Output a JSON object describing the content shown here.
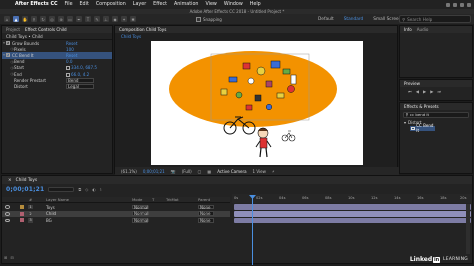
{
  "menubar": {
    "app_name": "After Effects CC",
    "items": [
      "File",
      "Edit",
      "Composition",
      "Layer",
      "Effect",
      "Animation",
      "View",
      "Window",
      "Help"
    ]
  },
  "window_title": "Adobe After Effects CC 2018 - Untitled Project *",
  "toolbar": {
    "snapping_label": "Snapping",
    "workspaces": [
      "Default",
      "Standard",
      "Small Screen"
    ],
    "active_workspace": "Standard",
    "help_search_placeholder": "Search Help"
  },
  "left_panel": {
    "tabs": [
      "Project",
      "Effect Controls Child"
    ],
    "active_tab": "Effect Controls Child",
    "layer_path": "Child Toys • Child",
    "effects": [
      {
        "name": "Grow Bounds",
        "reset": "Reset"
      },
      {
        "name": "Pixels",
        "value": "100",
        "indent": 1
      },
      {
        "name": "CC Bend It",
        "reset": "Reset",
        "highlighted": true
      },
      {
        "name": "Bend",
        "value": "0.0",
        "indent": 1
      },
      {
        "name": "Start",
        "value": "334.0, 687.5",
        "indent": 1
      },
      {
        "name": "End",
        "value": "66.0, 4.2",
        "indent": 1
      },
      {
        "name": "Render Prestart",
        "select": "Bend",
        "indent": 1
      },
      {
        "name": "Distort",
        "select": "Legal",
        "indent": 1
      }
    ]
  },
  "composition_panel": {
    "tab_label": "Composition Child Toys",
    "breadcrumb": "Child Toys",
    "zoom": "(61.1%)",
    "timecode": "0;00;01;21",
    "resolution": "(Full)",
    "camera": "Active Camera",
    "views": "1 View"
  },
  "right_panels": {
    "info_tabs": [
      "Info",
      "Audio"
    ],
    "preview_tab": "Preview",
    "effects_presets_tab": "Effects & Presets",
    "effects_search_value": "cc bend it",
    "category": "Distort",
    "result": "CC Bend It"
  },
  "timeline": {
    "tab_label": "Child Toys",
    "timecode": "0;00;01;21",
    "columns": [
      "#",
      "Layer Name",
      "Mode",
      "T",
      "TrkMat",
      "Parent"
    ],
    "layers": [
      {
        "number": "1",
        "name": "Toys",
        "mode": "Normal",
        "parent": "None",
        "label_color": "#b58c3c"
      },
      {
        "number": "2",
        "name": "Child",
        "mode": "Normal",
        "parent": "None",
        "label_color": "#b06070",
        "selected": true
      },
      {
        "number": "3",
        "name": "BG",
        "mode": "Normal",
        "parent": "None",
        "label_color": "#b06070"
      }
    ],
    "ruler_ticks": [
      "0s",
      "02s",
      "04s",
      "06s",
      "08s",
      "10s",
      "12s",
      "14s",
      "16s",
      "18s",
      "20s"
    ]
  },
  "branding": {
    "logo_main": "Linked",
    "logo_in": "in",
    "logo_suffix": "LEARNING"
  },
  "colors": {
    "accent_blue": "#4a8fe0",
    "orange_blob": "#f39200",
    "layer_bar": "#7d7ca4",
    "layer_bar_selected": "#8f8fba"
  }
}
